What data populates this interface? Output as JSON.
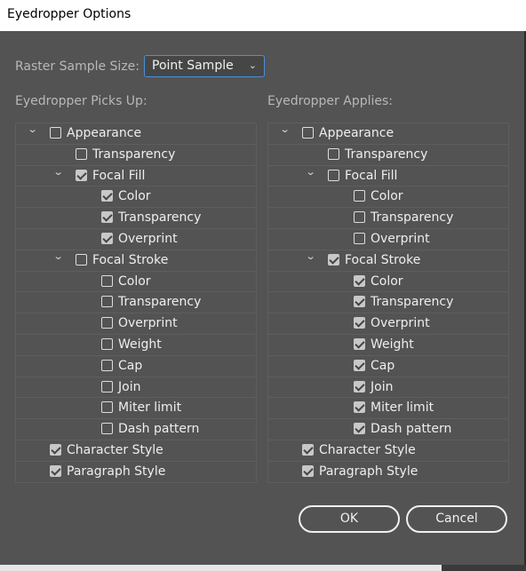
{
  "window": {
    "title": "Eyedropper Options"
  },
  "raster": {
    "label": "Raster Sample Size:",
    "value": "Point Sample"
  },
  "picks": {
    "heading": "Eyedropper Picks Up:",
    "rows": [
      {
        "label": "Appearance",
        "level": 0,
        "expander": true,
        "checked": false
      },
      {
        "label": "Transparency",
        "level": 1,
        "expander": false,
        "checked": false
      },
      {
        "label": "Focal Fill",
        "level": 1,
        "expander": true,
        "checked": true
      },
      {
        "label": "Color",
        "level": 2,
        "expander": false,
        "checked": true
      },
      {
        "label": "Transparency",
        "level": 2,
        "expander": false,
        "checked": true
      },
      {
        "label": "Overprint",
        "level": 2,
        "expander": false,
        "checked": true
      },
      {
        "label": "Focal Stroke",
        "level": 1,
        "expander": true,
        "checked": false
      },
      {
        "label": "Color",
        "level": 2,
        "expander": false,
        "checked": false
      },
      {
        "label": "Transparency",
        "level": 2,
        "expander": false,
        "checked": false
      },
      {
        "label": "Overprint",
        "level": 2,
        "expander": false,
        "checked": false
      },
      {
        "label": "Weight",
        "level": 2,
        "expander": false,
        "checked": false
      },
      {
        "label": "Cap",
        "level": 2,
        "expander": false,
        "checked": false
      },
      {
        "label": "Join",
        "level": 2,
        "expander": false,
        "checked": false
      },
      {
        "label": "Miter limit",
        "level": 2,
        "expander": false,
        "checked": false
      },
      {
        "label": "Dash pattern",
        "level": 2,
        "expander": false,
        "checked": false
      },
      {
        "label": "Character Style",
        "level": 0,
        "expander": false,
        "checked": true
      },
      {
        "label": "Paragraph Style",
        "level": 0,
        "expander": false,
        "checked": true
      }
    ]
  },
  "applies": {
    "heading": "Eyedropper Applies:",
    "rows": [
      {
        "label": "Appearance",
        "level": 0,
        "expander": true,
        "checked": false
      },
      {
        "label": "Transparency",
        "level": 1,
        "expander": false,
        "checked": false
      },
      {
        "label": "Focal Fill",
        "level": 1,
        "expander": true,
        "checked": false
      },
      {
        "label": "Color",
        "level": 2,
        "expander": false,
        "checked": false
      },
      {
        "label": "Transparency",
        "level": 2,
        "expander": false,
        "checked": false
      },
      {
        "label": "Overprint",
        "level": 2,
        "expander": false,
        "checked": false
      },
      {
        "label": "Focal Stroke",
        "level": 1,
        "expander": true,
        "checked": true
      },
      {
        "label": "Color",
        "level": 2,
        "expander": false,
        "checked": true
      },
      {
        "label": "Transparency",
        "level": 2,
        "expander": false,
        "checked": true
      },
      {
        "label": "Overprint",
        "level": 2,
        "expander": false,
        "checked": true
      },
      {
        "label": "Weight",
        "level": 2,
        "expander": false,
        "checked": true
      },
      {
        "label": "Cap",
        "level": 2,
        "expander": false,
        "checked": true
      },
      {
        "label": "Join",
        "level": 2,
        "expander": false,
        "checked": true
      },
      {
        "label": "Miter limit",
        "level": 2,
        "expander": false,
        "checked": true
      },
      {
        "label": "Dash pattern",
        "level": 2,
        "expander": false,
        "checked": true
      },
      {
        "label": "Character Style",
        "level": 0,
        "expander": false,
        "checked": true
      },
      {
        "label": "Paragraph Style",
        "level": 0,
        "expander": false,
        "checked": true
      }
    ]
  },
  "buttons": {
    "ok": "OK",
    "cancel": "Cancel"
  }
}
